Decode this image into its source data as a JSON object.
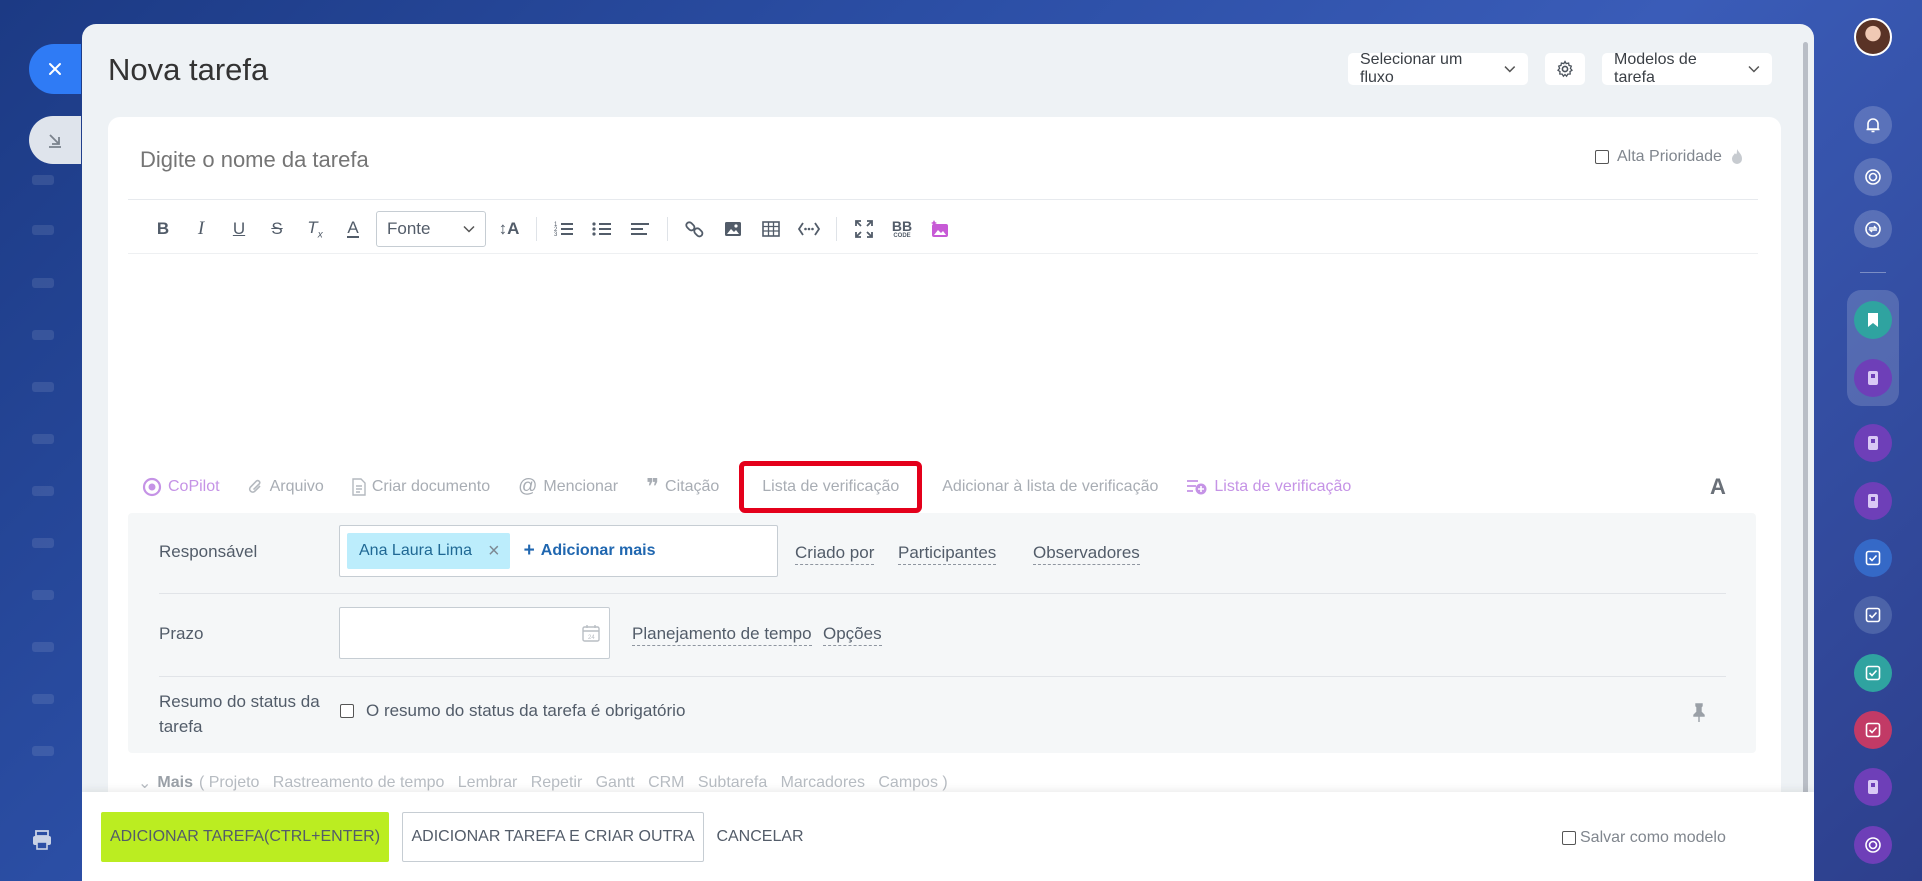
{
  "window": {
    "title": "Nova tarefa"
  },
  "header": {
    "flow_select": "Selecionar um fluxo",
    "templates_select": "Modelos de tarefa"
  },
  "task": {
    "name_placeholder": "Digite o nome da tarefa",
    "high_priority_label": "Alta Prioridade",
    "high_priority_checked": false
  },
  "editor": {
    "toolbar": [
      "bold-icon",
      "italic-icon",
      "underline-icon",
      "strikethrough-icon",
      "clear-format-icon",
      "text-color-icon",
      "font-select",
      "font-size-icon",
      "numbered-list-icon",
      "bulleted-list-icon",
      "align-icon",
      "link-icon",
      "image-icon",
      "table-icon",
      "code-icon",
      "fullscreen-icon",
      "bbcode-icon",
      "ai-image-icon"
    ],
    "font_label": "Fonte",
    "bb_label": "BB",
    "bb_sub": "CODE"
  },
  "actions": {
    "copilot": "CoPilot",
    "file": "Arquivo",
    "create_doc": "Criar documento",
    "mention": "Mencionar",
    "quote": "Citação",
    "checklist": "Lista de verificação",
    "add_to_checklist": "Adicionar à lista de verificação",
    "checklist_new": "Lista de verificação",
    "text_format": "A"
  },
  "fields": {
    "responsible_label": "Responsável",
    "responsible_user": "Ana Laura Lima",
    "add_more": "Adicionar mais",
    "created_by": "Criado por",
    "participants": "Participantes",
    "observers": "Observadores",
    "deadline_label": "Prazo",
    "time_planning": "Planejamento de tempo",
    "options": "Opções",
    "status_summary_label": "Resumo do status da tarefa",
    "status_summary_check": "O resumo do status da tarefa é obrigatório"
  },
  "more": {
    "label": "Mais",
    "items": "( Projeto   Rastreamento de tempo   Lembrar   Repetir   Gantt   CRM   Subtarefa   Marcadores   Campos )"
  },
  "footer": {
    "add_task": "ADICIONAR TAREFA(CTRL+ENTER)",
    "add_and_create": "ADICIONAR TAREFA E CRIAR OUTRA",
    "cancel": "CANCELAR",
    "save_as_template": "Salvar como modelo"
  },
  "colors": {
    "primary_button": "#bbed21",
    "highlight_border": "#e4001b",
    "chip_bg": "#bcedfc",
    "close_button": "#2f7bf5"
  }
}
